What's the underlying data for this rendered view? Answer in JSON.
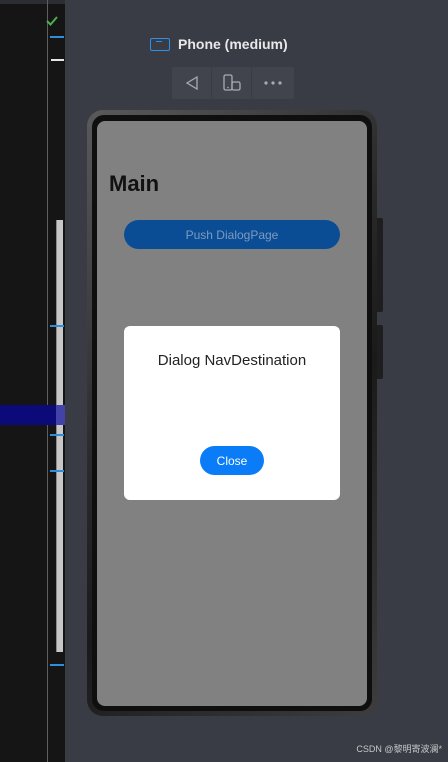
{
  "device": {
    "name": "Phone (medium)",
    "icon": "phone-device-icon"
  },
  "toolbar": {
    "buttons": [
      {
        "name": "back-triangle-icon"
      },
      {
        "name": "rotate-device-icon"
      },
      {
        "name": "more-options-icon"
      }
    ]
  },
  "app": {
    "title": "Main",
    "push_button_label": "Push DialogPage"
  },
  "dialog": {
    "title": "Dialog NavDestination",
    "close_label": "Close"
  },
  "watermark": "CSDN @黎明寄波澜*",
  "colors": {
    "background": "#393c44",
    "accent": "#0a7cf7",
    "push_button": "#0a4d94",
    "screen_overlay": "#818181"
  }
}
